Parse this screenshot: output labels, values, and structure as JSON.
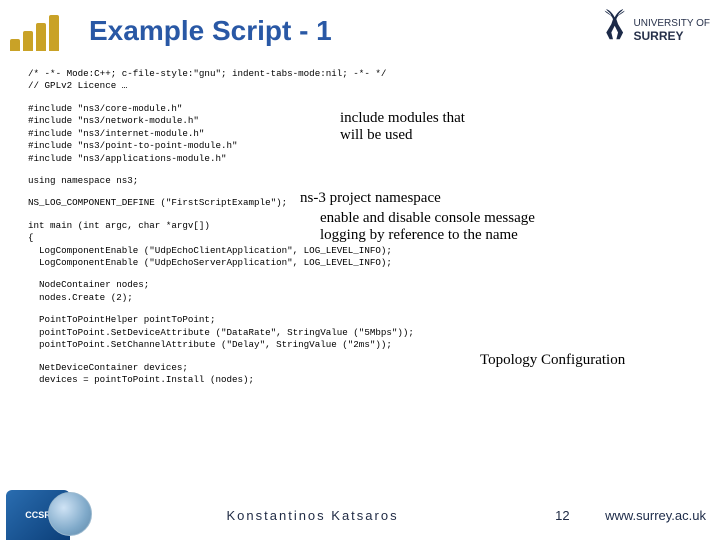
{
  "header": {
    "title": "Example Script - 1",
    "university_line1": "UNIVERSITY OF",
    "university_line2": "SURREY"
  },
  "code": {
    "block1": "/* -*- Mode:C++; c-file-style:\"gnu\"; indent-tabs-mode:nil; -*- */\n// GPLv2 Licence …",
    "block2": "#include \"ns3/core-module.h\"\n#include \"ns3/network-module.h\"\n#include \"ns3/internet-module.h\"\n#include \"ns3/point-to-point-module.h\"\n#include \"ns3/applications-module.h\"",
    "block3": "using namespace ns3;",
    "block4": "NS_LOG_COMPONENT_DEFINE (\"FirstScriptExample\");",
    "block5": "int main (int argc, char *argv[])\n{\n  LogComponentEnable (\"UdpEchoClientApplication\", LOG_LEVEL_INFO);\n  LogComponentEnable (\"UdpEchoServerApplication\", LOG_LEVEL_INFO);",
    "block6": "  NodeContainer nodes;\n  nodes.Create (2);",
    "block7": "  PointToPointHelper pointToPoint;\n  pointToPoint.SetDeviceAttribute (\"DataRate\", StringValue (\"5Mbps\"));\n  pointToPoint.SetChannelAttribute (\"Delay\", StringValue (\"2ms\"));",
    "block8": "  NetDeviceContainer devices;\n  devices = pointToPoint.Install (nodes);"
  },
  "annotations": {
    "includes": "include modules that\nwill be used",
    "namespace": "ns-3 project namespace",
    "logging": "enable and disable console message\nlogging by reference to the name",
    "topology": "Topology Configuration"
  },
  "footer": {
    "badge": "CCSR",
    "author": "Konstantinos  Katsaros",
    "page": "12",
    "site": "www.surrey.ac.uk"
  }
}
